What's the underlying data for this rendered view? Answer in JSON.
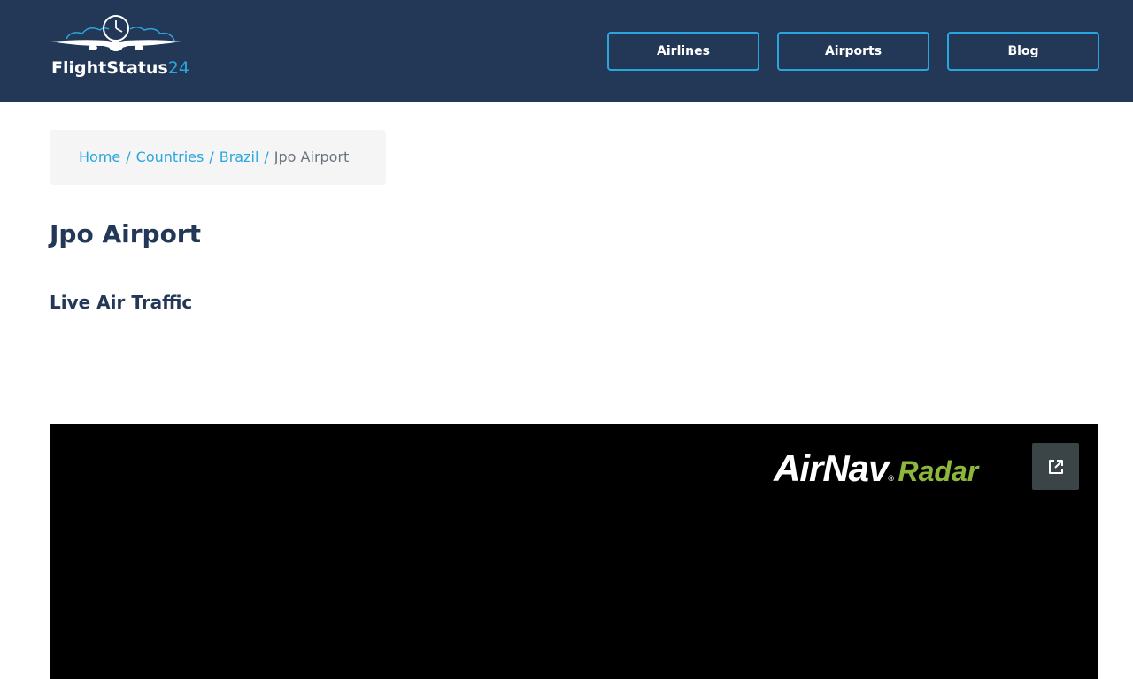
{
  "brand": {
    "name_main": "FlightStatus",
    "name_accent": "24"
  },
  "nav": {
    "items": [
      {
        "label": "Airlines"
      },
      {
        "label": "Airports"
      },
      {
        "label": "Blog"
      }
    ]
  },
  "breadcrumb": {
    "items": [
      {
        "label": "Home"
      },
      {
        "label": "Countries"
      },
      {
        "label": "Brazil"
      }
    ],
    "separator": "/",
    "current": "Jpo Airport"
  },
  "page": {
    "title": "Jpo Airport",
    "section_title": "Live Air Traffic"
  },
  "radar": {
    "logo_main": "AirNav",
    "logo_reg": "®",
    "logo_accent": "Radar",
    "external_icon": "external-link-icon"
  },
  "colors": {
    "header_bg": "#233757",
    "accent": "#2aa6df",
    "radar_green": "#8cb63c"
  }
}
